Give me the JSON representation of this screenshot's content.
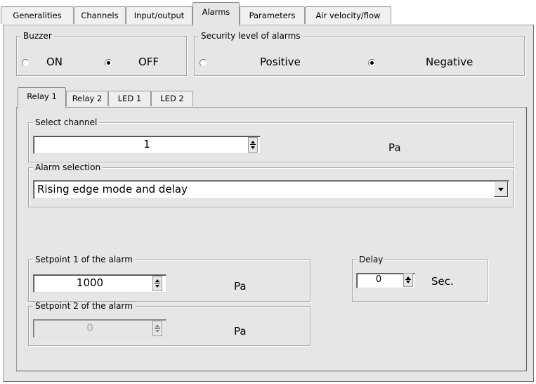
{
  "tabs": [
    {
      "label": "Generalities"
    },
    {
      "label": "Channels"
    },
    {
      "label": "Input/output"
    },
    {
      "label": "Alarms"
    },
    {
      "label": "Parameters"
    },
    {
      "label": "Air velocity/flow"
    }
  ],
  "active_tab": "Alarms",
  "buzzer": {
    "title": "Buzzer",
    "on_label": "ON",
    "off_label": "OFF",
    "selected": "OFF"
  },
  "security": {
    "title": "Security level of alarms",
    "positive_label": "Positive",
    "negative_label": "Negative",
    "selected": "Negative"
  },
  "subtabs": [
    {
      "label": "Relay 1"
    },
    {
      "label": "Relay 2"
    },
    {
      "label": "LED 1"
    },
    {
      "label": "LED 2"
    }
  ],
  "active_subtab": "Relay 1",
  "select_channel": {
    "title": "Select channel",
    "value": "1",
    "unit": "Pa"
  },
  "alarm_selection": {
    "title": "Alarm selection",
    "value": "Rising edge mode and delay"
  },
  "setpoint1": {
    "title": "Setpoint 1 of the alarm",
    "value": "1000",
    "unit": "Pa"
  },
  "setpoint2": {
    "title": "Setpoint 2 of the alarm",
    "value": "0",
    "unit": "Pa",
    "disabled": true
  },
  "delay": {
    "title": "Delay",
    "value": "0",
    "unit": "Sec."
  }
}
